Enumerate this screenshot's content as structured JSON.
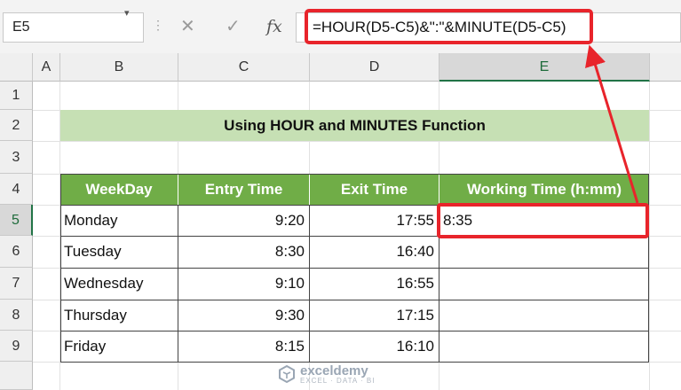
{
  "formula_bar": {
    "name_box": "E5",
    "cancel_icon": "✕",
    "enter_icon": "✓",
    "fx_label": "fx",
    "formula": "=HOUR(D5-C5)&\":\"&MINUTE(D5-C5)"
  },
  "columns": [
    "A",
    "B",
    "C",
    "D",
    "E"
  ],
  "rows": [
    "1",
    "2",
    "3",
    "4",
    "5",
    "6",
    "7",
    "8",
    "9"
  ],
  "selected_cell": "E5",
  "sheet": {
    "title": "Using HOUR and MINUTES Function",
    "headers": [
      "WeekDay",
      "Entry Time",
      "Exit Time",
      "Working Time (h:mm)"
    ],
    "data": [
      {
        "day": "Monday",
        "entry": "9:20",
        "exit": "17:55",
        "working": "8:35"
      },
      {
        "day": "Tuesday",
        "entry": "8:30",
        "exit": "16:40",
        "working": ""
      },
      {
        "day": "Wednesday",
        "entry": "9:10",
        "exit": "16:55",
        "working": ""
      },
      {
        "day": "Thursday",
        "entry": "9:30",
        "exit": "17:15",
        "working": ""
      },
      {
        "day": "Friday",
        "entry": "8:15",
        "exit": "16:10",
        "working": ""
      }
    ]
  },
  "watermark": {
    "name": "exceldemy",
    "tagline": "EXCEL · DATA · BI"
  },
  "colors": {
    "title_fill": "#c6e0b4",
    "header_fill": "#70ad47",
    "highlight": "#e8242b",
    "selection": "#217346"
  }
}
